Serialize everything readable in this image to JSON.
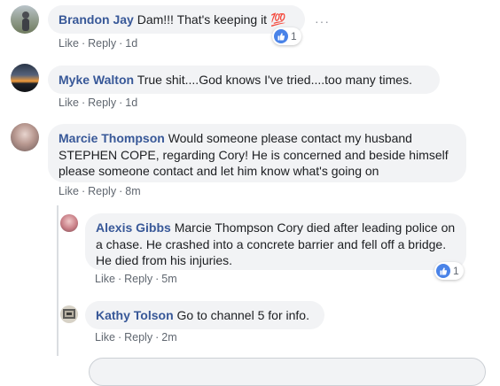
{
  "comments": [
    {
      "name": "Brandon Jay",
      "text": "Dam!!! That's keeping it 💯",
      "actions": {
        "like": "Like",
        "reply": "Reply",
        "time": "1d"
      },
      "reaction_count": "1"
    },
    {
      "name": "Myke Walton",
      "text": "True shit....God knows I've tried....too many times.",
      "actions": {
        "like": "Like",
        "reply": "Reply",
        "time": "1d"
      }
    },
    {
      "name": "Marcie Thompson",
      "text": "Would someone please contact my husband STEPHEN COPE, regarding Cory! He is concerned and beside himself please someone contact and let him know what's going on",
      "actions": {
        "like": "Like",
        "reply": "Reply",
        "time": "8m"
      }
    }
  ],
  "replies": [
    {
      "name": "Alexis Gibbs",
      "text": "Marcie Thompson Cory died after leading police on a chase. He crashed into a concrete barrier and fell off a bridge. He died from his injuries.",
      "actions": {
        "like": "Like",
        "reply": "Reply",
        "time": "5m"
      },
      "reaction_count": "1"
    },
    {
      "name": "Kathy Tolson",
      "text": "Go to channel 5 for info.",
      "actions": {
        "like": "Like",
        "reply": "Reply",
        "time": "2m"
      }
    }
  ],
  "separator": "·",
  "more_options": "···",
  "colors": {
    "name": "#385898",
    "bubble": "#f2f3f5",
    "like_blue": "#4a83e8"
  }
}
